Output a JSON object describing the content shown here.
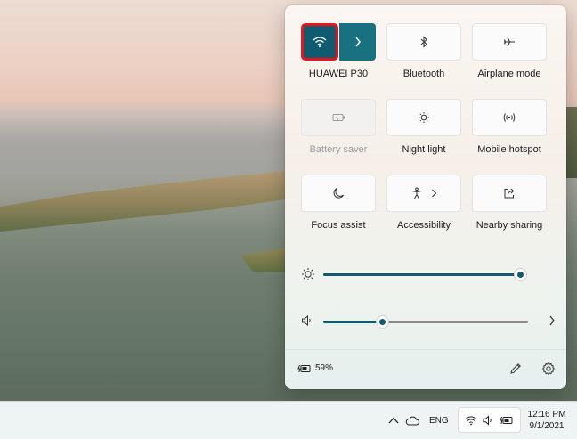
{
  "quick_settings": {
    "tiles": [
      {
        "id": "wifi",
        "label": "HUAWEI P30",
        "icon": "wifi-icon",
        "active": true,
        "has_more": true
      },
      {
        "id": "bluetooth",
        "label": "Bluetooth",
        "icon": "bluetooth-icon",
        "active": false
      },
      {
        "id": "airplane",
        "label": "Airplane mode",
        "icon": "airplane-icon",
        "active": false
      },
      {
        "id": "battery-saver",
        "label": "Battery saver",
        "icon": "battery-saver-icon",
        "active": false,
        "disabled": true
      },
      {
        "id": "night-light",
        "label": "Night light",
        "icon": "sun-icon",
        "active": false
      },
      {
        "id": "mobile-hotspot",
        "label": "Mobile hotspot",
        "icon": "hotspot-icon",
        "active": false
      },
      {
        "id": "focus-assist",
        "label": "Focus assist",
        "icon": "moon-icon",
        "active": false
      },
      {
        "id": "accessibility",
        "label": "Accessibility",
        "icon": "accessibility-icon",
        "active": false,
        "has_more": true
      },
      {
        "id": "nearby-sharing",
        "label": "Nearby sharing",
        "icon": "share-icon",
        "active": false
      }
    ],
    "brightness": {
      "icon": "brightness-icon",
      "level": 1.0
    },
    "volume": {
      "icon": "speaker-icon",
      "level": 0.29
    },
    "footer": {
      "battery_percent": "59%",
      "battery_icon": "battery-charging-icon",
      "edit_icon": "pencil-icon",
      "settings_icon": "gear-icon"
    }
  },
  "taskbar": {
    "chevron_icon": "chevron-up-icon",
    "onedrive_icon": "cloud-icon",
    "language": "ENG",
    "status_icons": [
      "wifi-icon",
      "speaker-icon",
      "battery-charging-icon"
    ],
    "time": "12:16 PM",
    "date": "9/1/2021"
  },
  "colors": {
    "accent": "#115b70",
    "accent_secondary": "#19707f",
    "highlight_border": "#e8141c",
    "taskbar": "#eef3f4"
  }
}
